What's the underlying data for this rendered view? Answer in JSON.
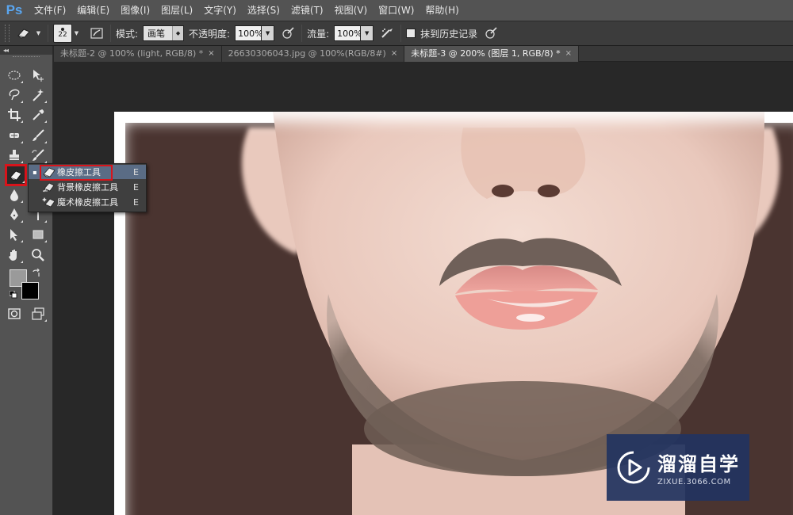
{
  "app": {
    "logo": "Ps"
  },
  "menu": [
    "文件(F)",
    "编辑(E)",
    "图像(I)",
    "图层(L)",
    "文字(Y)",
    "选择(S)",
    "滤镜(T)",
    "视图(V)",
    "窗口(W)",
    "帮助(H)"
  ],
  "options": {
    "brush_size": "22",
    "mode_label": "模式:",
    "mode_value": "画笔",
    "opacity_label": "不透明度:",
    "opacity_value": "100%",
    "flow_label": "流量:",
    "flow_value": "100%",
    "erase_history_label": "抹到历史记录",
    "erase_history_checked": false
  },
  "tabs": [
    {
      "label": "未标题-2 @ 100% (light, RGB/8) *",
      "active": false
    },
    {
      "label": "26630306043.jpg @ 100%(RGB/8#)",
      "active": false
    },
    {
      "label": "未标题-3 @ 200% (图层 1, RGB/8) *",
      "active": true
    }
  ],
  "tab_close_glyph": "×",
  "tool_panel": {
    "collapse_glyph": "◂◂",
    "foreground_color": "#9a9a9a",
    "background_color": "#000000"
  },
  "flyout": {
    "items": [
      {
        "label": "橡皮擦工具",
        "shortcut": "E",
        "selected": true,
        "icon": "eraser-icon"
      },
      {
        "label": "背景橡皮擦工具",
        "shortcut": "E",
        "selected": false,
        "icon": "background-eraser-icon"
      },
      {
        "label": "魔术橡皮擦工具",
        "shortcut": "E",
        "selected": false,
        "icon": "magic-eraser-icon"
      }
    ],
    "bullet": "▪"
  },
  "watermark": {
    "title": "溜溜自学",
    "url": "ZIXUE.3066.COM"
  },
  "colors": {
    "highlight_red": "#d8141b",
    "menu_bg": "#535353",
    "ps_blue": "#5aa6f0",
    "watermark_bg": "#223460"
  }
}
